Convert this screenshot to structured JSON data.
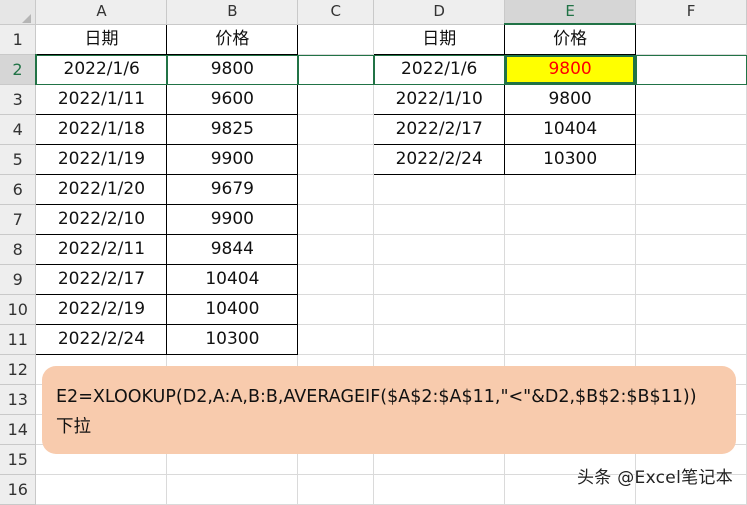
{
  "columns": [
    "A",
    "B",
    "C",
    "D",
    "E",
    "F"
  ],
  "rows": [
    {
      "num": "1",
      "a": "日期",
      "b": "价格",
      "d": "日期",
      "e": "价格"
    },
    {
      "num": "2",
      "a": "2022/1/6",
      "b": "9800",
      "d": "2022/1/6",
      "e": "9800"
    },
    {
      "num": "3",
      "a": "2022/1/11",
      "b": "9600",
      "d": "2022/1/10",
      "e": "9800"
    },
    {
      "num": "4",
      "a": "2022/1/18",
      "b": "9825",
      "d": "2022/2/17",
      "e": "10404"
    },
    {
      "num": "5",
      "a": "2022/1/19",
      "b": "9900",
      "d": "2022/2/24",
      "e": "10300"
    },
    {
      "num": "6",
      "a": "2022/1/20",
      "b": "9679",
      "d": "",
      "e": ""
    },
    {
      "num": "7",
      "a": "2022/2/10",
      "b": "9900",
      "d": "",
      "e": ""
    },
    {
      "num": "8",
      "a": "2022/2/11",
      "b": "9844",
      "d": "",
      "e": ""
    },
    {
      "num": "9",
      "a": "2022/2/17",
      "b": "10404",
      "d": "",
      "e": ""
    },
    {
      "num": "10",
      "a": "2022/2/19",
      "b": "10400",
      "d": "",
      "e": ""
    },
    {
      "num": "11",
      "a": "2022/2/24",
      "b": "10300",
      "d": "",
      "e": ""
    },
    {
      "num": "12",
      "a": "",
      "b": "",
      "d": "",
      "e": ""
    },
    {
      "num": "13",
      "a": "",
      "b": "",
      "d": "",
      "e": ""
    },
    {
      "num": "14",
      "a": "",
      "b": "",
      "d": "",
      "e": ""
    },
    {
      "num": "15",
      "a": "",
      "b": "",
      "d": "",
      "e": ""
    },
    {
      "num": "16",
      "a": "",
      "b": "",
      "d": "",
      "e": ""
    }
  ],
  "callout": {
    "formula": "E2=XLOOKUP(D2,A:A,B:B,AVERAGEIF($A$2:$A$11,\"<\"&D2,$B$2:$B$11))",
    "note": "下拉"
  },
  "watermark": "头条 @Excel笔记本",
  "colors": {
    "highlight_fill": "#ffff00",
    "highlight_text": "#ff0000",
    "callout_bg": "#f8cbad",
    "selection": "#217346"
  }
}
